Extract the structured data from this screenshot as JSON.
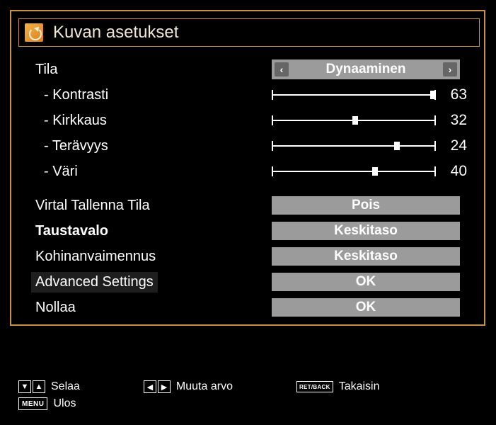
{
  "title": "Kuvan asetukset",
  "mode": {
    "label": "Tila",
    "value": "Dynaaminen"
  },
  "sliders": {
    "contrast": {
      "label": "- Kontrasti",
      "value": 63,
      "max": 63
    },
    "brightness": {
      "label": "- Kirkkaus",
      "value": 32,
      "max": 63
    },
    "sharpness": {
      "label": "- Terävyys",
      "value": 24,
      "max": 31
    },
    "colour": {
      "label": "- Väri",
      "value": 40,
      "max": 63
    }
  },
  "options": {
    "power_save": {
      "label": "Virtal Tallenna Tila",
      "value": "Pois"
    },
    "backlight": {
      "label": "Taustavalo",
      "value": "Keskitaso"
    },
    "noise": {
      "label": "Kohinanvaimennus",
      "value": "Keskitaso"
    },
    "advanced": {
      "label": "Advanced Settings",
      "value": "OK"
    },
    "reset": {
      "label": "Nollaa",
      "value": "OK"
    }
  },
  "hints": {
    "scroll": "Selaa",
    "change": "Muuta arvo",
    "back": "Takaisin",
    "exit": "Ulos",
    "menu_key": "MENU",
    "ret_key": "RET/BACK"
  }
}
